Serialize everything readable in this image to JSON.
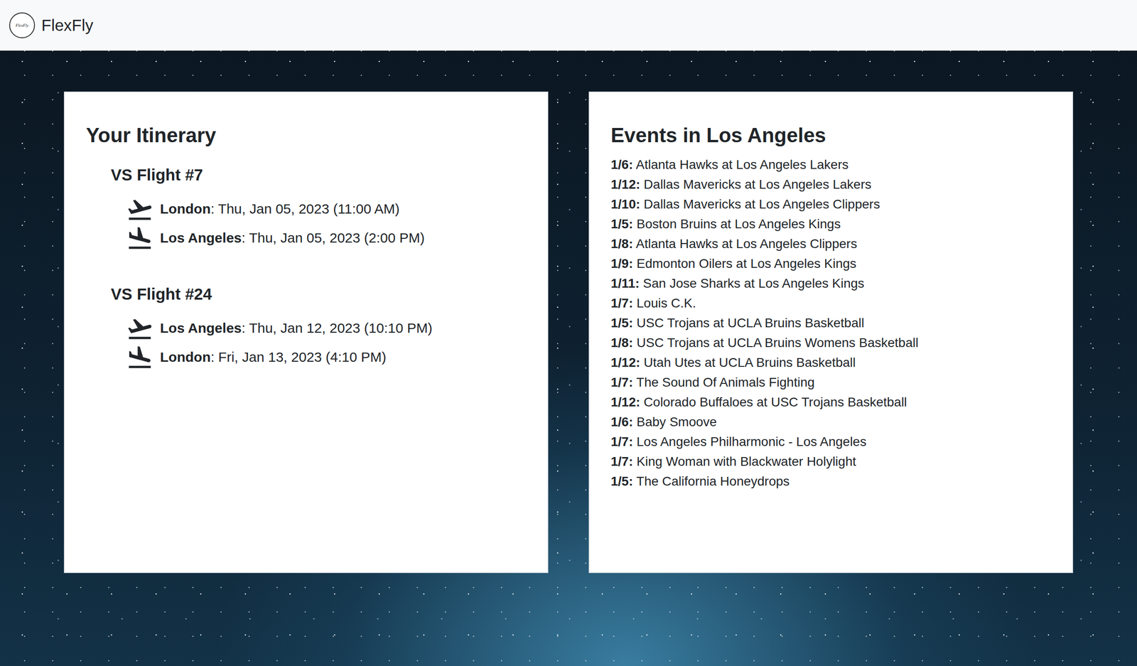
{
  "navbar": {
    "logo_text": "FlexFly",
    "brand": "FlexFly"
  },
  "itinerary": {
    "title": "Your Itinerary",
    "flights": [
      {
        "title": "VS Flight #7",
        "legs": [
          {
            "kind": "departure",
            "city": "London",
            "detail": ": Thu, Jan 05, 2023 (11:00 AM)"
          },
          {
            "kind": "arrival",
            "city": "Los Angeles",
            "detail": ": Thu, Jan 05, 2023 (2:00 PM)"
          }
        ]
      },
      {
        "title": "VS Flight #24",
        "legs": [
          {
            "kind": "departure",
            "city": "Los Angeles",
            "detail": ": Thu, Jan 12, 2023 (10:10 PM)"
          },
          {
            "kind": "arrival",
            "city": "London",
            "detail": ": Fri, Jan 13, 2023 (4:10 PM)"
          }
        ]
      }
    ]
  },
  "events": {
    "title": "Events in Los Angeles",
    "items": [
      {
        "date": "1/6:",
        "name": "Atlanta Hawks at Los Angeles Lakers"
      },
      {
        "date": "1/12:",
        "name": "Dallas Mavericks at Los Angeles Lakers"
      },
      {
        "date": "1/10:",
        "name": "Dallas Mavericks at Los Angeles Clippers"
      },
      {
        "date": "1/5:",
        "name": "Boston Bruins at Los Angeles Kings"
      },
      {
        "date": "1/8:",
        "name": "Atlanta Hawks at Los Angeles Clippers"
      },
      {
        "date": "1/9:",
        "name": "Edmonton Oilers at Los Angeles Kings"
      },
      {
        "date": "1/11:",
        "name": "San Jose Sharks at Los Angeles Kings"
      },
      {
        "date": "1/7:",
        "name": "Louis C.K."
      },
      {
        "date": "1/5:",
        "name": "USC Trojans at UCLA Bruins Basketball"
      },
      {
        "date": "1/8:",
        "name": "USC Trojans at UCLA Bruins Womens Basketball"
      },
      {
        "date": "1/12:",
        "name": "Utah Utes at UCLA Bruins Basketball"
      },
      {
        "date": "1/7:",
        "name": "The Sound Of Animals Fighting"
      },
      {
        "date": "1/12:",
        "name": "Colorado Buffaloes at USC Trojans Basketball"
      },
      {
        "date": "1/6:",
        "name": "Baby Smoove"
      },
      {
        "date": "1/7:",
        "name": "Los Angeles Philharmonic - Los Angeles"
      },
      {
        "date": "1/7:",
        "name": "King Woman with Blackwater Holylight"
      },
      {
        "date": "1/5:",
        "name": "The California Honeydrops"
      }
    ]
  }
}
